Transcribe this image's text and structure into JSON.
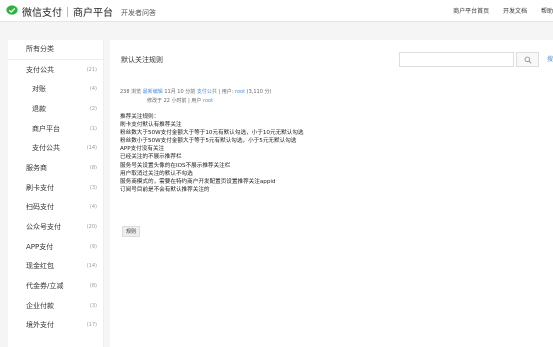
{
  "header": {
    "brand_name": "微信支付",
    "platform": "商户平台",
    "dev_qa": "开发者问答",
    "nav": [
      "商户平台首页",
      "开发文档",
      "帮助"
    ]
  },
  "sidebar": {
    "items": [
      {
        "label": "所有分类",
        "count": ""
      },
      {
        "label": "支付公共",
        "count": "(21)"
      },
      {
        "label": "对账",
        "count": "(4)"
      },
      {
        "label": "退款",
        "count": "(2)"
      },
      {
        "label": "商户平台",
        "count": "(1)"
      },
      {
        "label": "支付公共",
        "count": "(14)"
      },
      {
        "label": "服务商",
        "count": "(8)"
      },
      {
        "label": "刷卡支付",
        "count": "(3)"
      },
      {
        "label": "扫码支付",
        "count": "(4)"
      },
      {
        "label": "公众号支付",
        "count": "(20)"
      },
      {
        "label": "APP支付",
        "count": "(9)"
      },
      {
        "label": "现金红包",
        "count": "(14)"
      },
      {
        "label": "代金券/立减",
        "count": "(8)"
      },
      {
        "label": "企业付款",
        "count": "(3)"
      },
      {
        "label": "境外支付",
        "count": "(17)"
      }
    ]
  },
  "main": {
    "title": "默认关注规则",
    "search": {
      "placeholder": ""
    },
    "edge_text": "搜",
    "meta": {
      "views": "238 浏览",
      "latest_label": "最新编辑",
      "date": "11月 10 分前",
      "category": "支付公共",
      "user_prefix": "| 用户:",
      "user": "root",
      "user_count": "(3,110 分)",
      "modified": "修改于 22 小时前 | 用户",
      "modified_user": "root"
    },
    "lines": [
      "推荐关注规则：",
      "刷卡支付默认有推荐关注",
      "粉丝数大于50W支付金额大于等于10元有默认勾选，小于10元无默认勾选",
      "粉丝数小于50W支付金额大于等于5元有默认勾选，小于5元无默认勾选",
      "APP支付没有关注",
      "已经关注的不展示推荐栏",
      "服务号关设置头像的在IOS不展示推荐关注栏",
      "用户取消过关注的默认不勾选",
      "服务商模式的，需要在特约商户开发配置页设置推荐关注appid",
      "订阅号目前是不会有默认推荐关注的"
    ],
    "tag": "规则"
  },
  "colors": {
    "accent": "#4a90d9",
    "brand_green": "#2ab43c"
  },
  "icons": {
    "logo": "wechat-pay-logo-icon",
    "search": "search-icon"
  }
}
